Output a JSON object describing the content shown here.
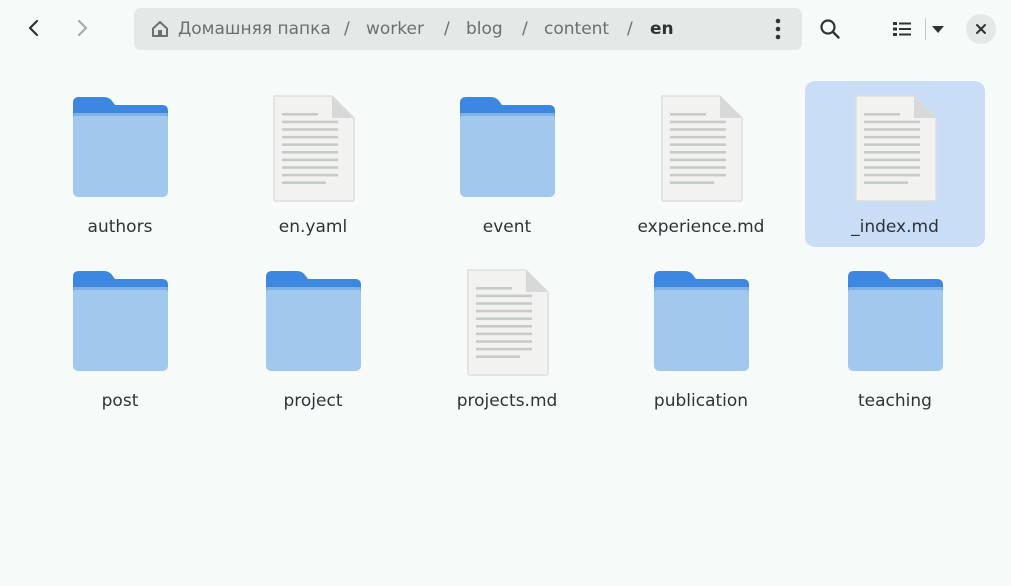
{
  "header": {
    "back_label": "back",
    "forward_label": "forward",
    "path": [
      {
        "label": "Домашняя папка",
        "icon": "home-icon"
      },
      {
        "label": "worker"
      },
      {
        "label": "blog"
      },
      {
        "label": "content"
      },
      {
        "label": "en"
      }
    ],
    "separator": "/",
    "menu_icon": "kebab-menu-icon",
    "search_icon": "search-icon",
    "view_icon": "list-view-icon",
    "view_options_icon": "chevron-down-icon",
    "close_icon": "close-icon"
  },
  "files": [
    {
      "name": "authors",
      "type": "folder",
      "selected": false
    },
    {
      "name": "en.yaml",
      "type": "document",
      "selected": false
    },
    {
      "name": "event",
      "type": "folder",
      "selected": false
    },
    {
      "name": "experience.md",
      "type": "document",
      "selected": false
    },
    {
      "name": "_index.md",
      "type": "document",
      "selected": true
    },
    {
      "name": "post",
      "type": "folder",
      "selected": false
    },
    {
      "name": "project",
      "type": "folder",
      "selected": false
    },
    {
      "name": "projects.md",
      "type": "document",
      "selected": false
    },
    {
      "name": "publication",
      "type": "folder",
      "selected": false
    },
    {
      "name": "teaching",
      "type": "folder",
      "selected": false
    }
  ],
  "colors": {
    "folder_back": "#3d87e0",
    "folder_front": "#a3c8ee",
    "selection": "#c9def6",
    "background": "#f6faf8"
  }
}
